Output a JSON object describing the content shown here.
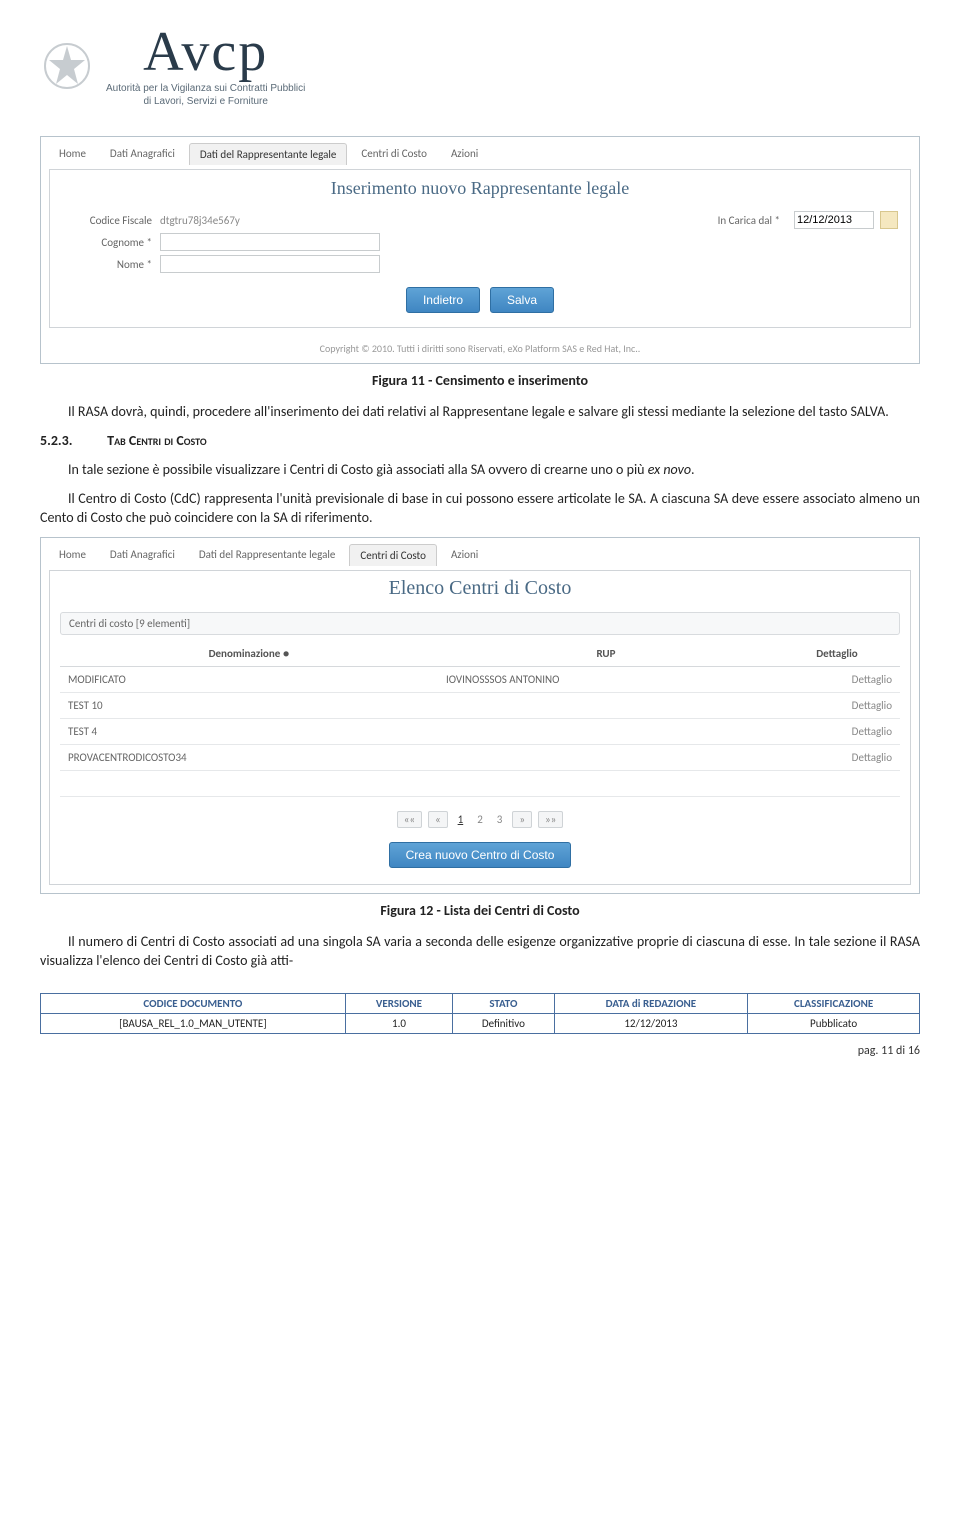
{
  "header": {
    "brand": "Avcp",
    "subtitle_l1": "Autorità per la Vigilanza sui Contratti Pubblici",
    "subtitle_l2": "di Lavori, Servizi e Forniture"
  },
  "screenshot1": {
    "tabs": [
      "Home",
      "Dati Anagrafici",
      "Dati del Rappresentante legale",
      "Centri di Costo",
      "Azioni"
    ],
    "active_tab": 2,
    "title": "Inserimento nuovo Rappresentante legale",
    "fields": {
      "codice_fiscale_label": "Codice Fiscale",
      "codice_fiscale_value": "dtgtru78j34e567y",
      "cognome_label": "Cognome *",
      "nome_label": "Nome *",
      "in_carica_label": "In Carica dal *",
      "in_carica_value": "12/12/2013"
    },
    "buttons": {
      "indietro": "Indietro",
      "salva": "Salva"
    },
    "copyright": "Copyright © 2010. Tutti i diritti sono Riservati, eXo Platform SAS e Red Hat, Inc.."
  },
  "caption1": "Figura 11 - Censimento e inserimento",
  "para1": "Il RASA dovrà, quindi, procedere all'inserimento dei dati relativi al Rappresentane legale e salvare gli stessi mediante la selezione del tasto SALVA.",
  "section": {
    "num": "5.2.3.",
    "title": "Tab Centri di Costo"
  },
  "para2a": "In tale sezione è possibile visualizzare i Centri di Costo già associati alla SA ovvero di crearne uno o più ",
  "para2b_italic": "ex novo",
  "para2c": ".",
  "para3": "Il Centro di Costo (CdC) rappresenta l'unità previsionale di base in cui possono essere articolate le SA. A ciascuna SA  deve essere associato almeno un Cento di Costo che può coincidere con la SA di riferimento.",
  "screenshot2": {
    "tabs": [
      "Home",
      "Dati Anagrafici",
      "Dati del Rappresentante legale",
      "Centri di Costo",
      "Azioni"
    ],
    "active_tab": 3,
    "title": "Elenco Centri di Costo",
    "count_label": "Centri di costo [9 elementi]",
    "columns": {
      "denom": "Denominazione  ●",
      "rup": "RUP",
      "dettaglio": "Dettaglio"
    },
    "rows": [
      {
        "denom": "MODIFICATO",
        "rup": "IOVINOSSSOS ANTONINO",
        "dettaglio": "Dettaglio"
      },
      {
        "denom": "TEST 10",
        "rup": "",
        "dettaglio": "Dettaglio"
      },
      {
        "denom": "TEST 4",
        "rup": "",
        "dettaglio": "Dettaglio"
      },
      {
        "denom": "PROVACENTRODICOSTO34",
        "rup": "",
        "dettaglio": "Dettaglio"
      }
    ],
    "pager": {
      "first": "««",
      "prev": "«",
      "pages": [
        "1",
        "2",
        "3"
      ],
      "next": "»",
      "last": "»»"
    },
    "create_btn": "Crea nuovo Centro di Costo"
  },
  "caption2": "Figura 12 - Lista dei Centri di Costo",
  "para4": "Il numero di Centri di Costo associati ad una singola SA varia a seconda delle esigenze organizzative proprie di ciascuna di esse. In tale sezione il RASA visualizza l'elenco dei Centri di Costo già atti-",
  "footer": {
    "h1": "CODICE DOCUMENTO",
    "v1": "[BAUSA_REL_1.0_MAN_UTENTE]",
    "h2": "VERSIONE",
    "v2": "1.0",
    "h3": "STATO",
    "v3": "Definitivo",
    "h4": "DATA di REDAZIONE",
    "v4": "12/12/2013",
    "h5": "CLASSIFICAZIONE",
    "v5": "Pubblicato"
  },
  "page_num": "pag. 11 di 16"
}
